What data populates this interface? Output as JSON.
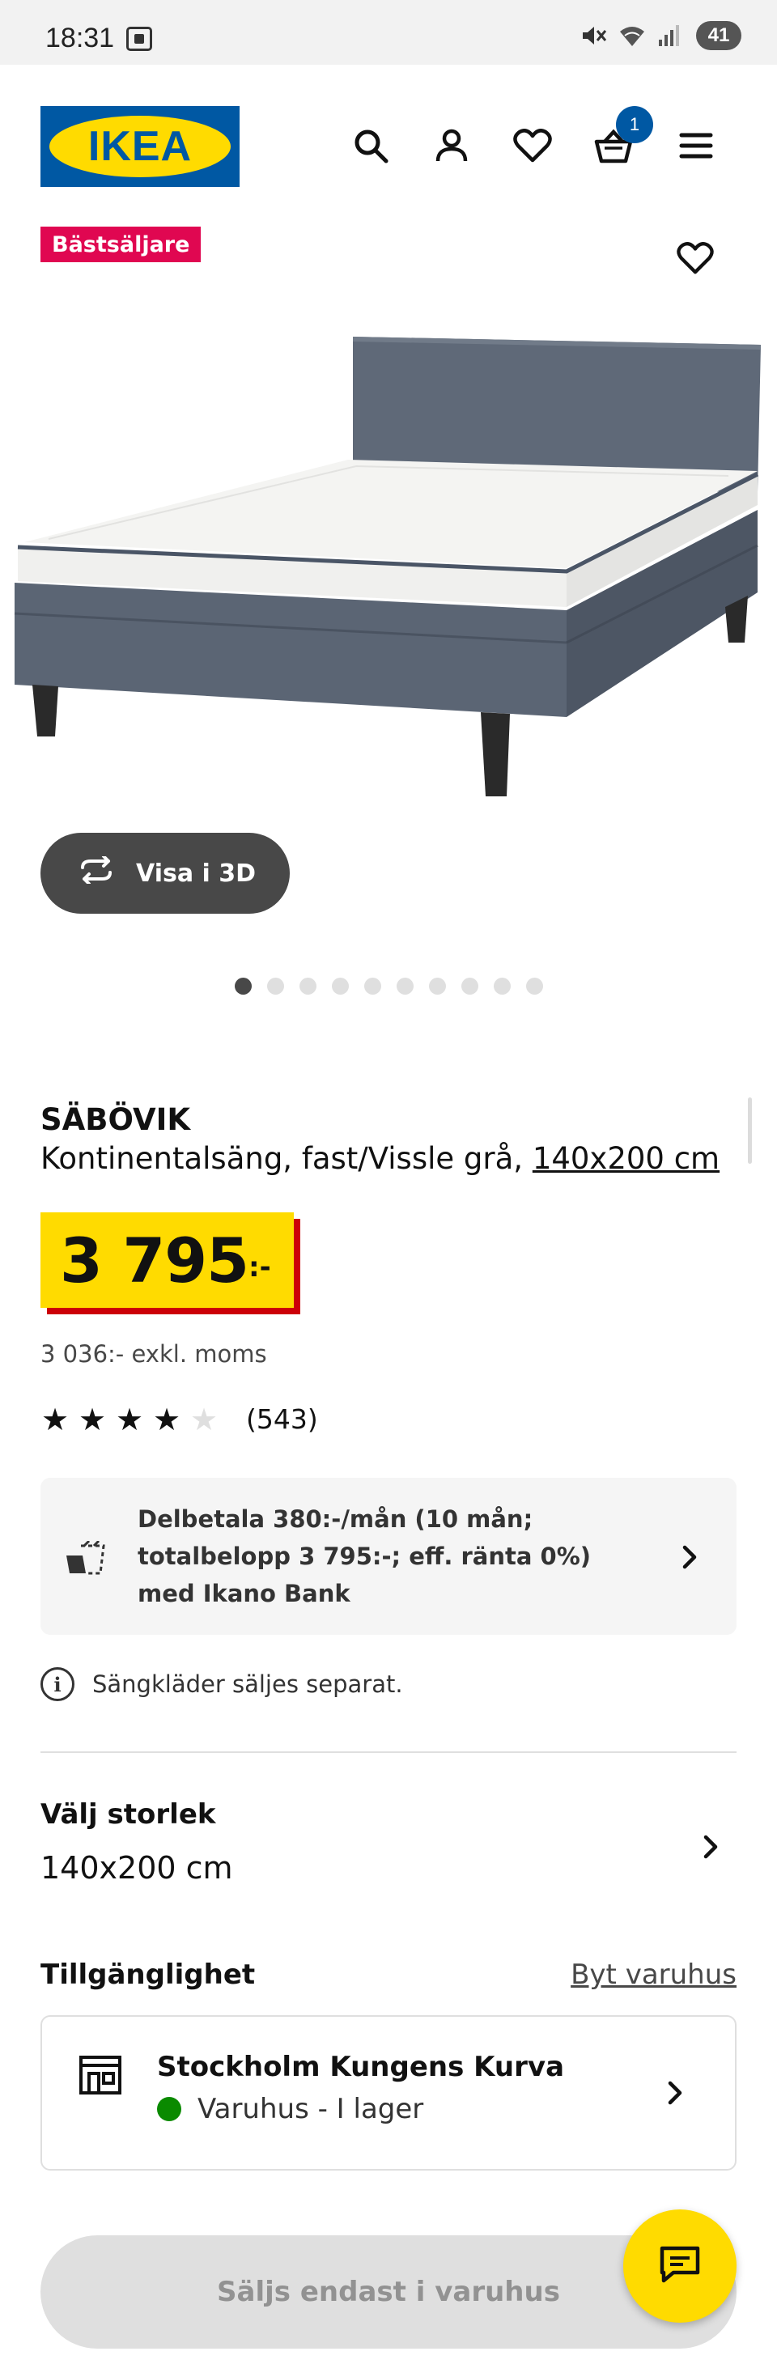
{
  "status_bar": {
    "time": "18:31",
    "battery": "41",
    "icons": [
      "screen-record-icon",
      "mute-icon",
      "wifi-icon",
      "signal-icon",
      "battery-icon"
    ]
  },
  "header": {
    "logo_text": "IKEA",
    "cart_count": "1",
    "icons": [
      "search-icon",
      "account-icon",
      "heart-icon",
      "cart-icon",
      "menu-icon"
    ]
  },
  "product": {
    "badge": "Bästsäljare",
    "view_3d_label": "Visa i 3D",
    "image_count": 10,
    "active_image": 1,
    "name": "SÄBÖVIK",
    "description": "Kontinentalsäng, fast/Vissle grå, ",
    "size_link": "140x200 cm",
    "price": "3 795",
    "price_suffix": ":-",
    "price_exkl": "3 036:- exkl. moms",
    "rating": 4,
    "rating_max": 5,
    "reviews": "(543)",
    "finance_text": "Delbetala 380:-/mån (10 mån; totalbelopp 3 795:-; eff. ränta 0%) med Ikano Bank",
    "note": "Sängkläder säljes separat."
  },
  "size_selector": {
    "label": "Välj storlek",
    "value": "140x200 cm"
  },
  "availability": {
    "label": "Tillgänglighet",
    "change_store": "Byt varuhus",
    "store_name": "Stockholm Kungens Kurva",
    "store_status": "Varuhus - I lager"
  },
  "buy_button": "Säljs endast i varuhus",
  "colors": {
    "ikea_blue": "#0058a3",
    "ikea_yellow": "#ffdb00",
    "badge_red": "#e00751",
    "price_shadow": "#cc0008",
    "stock_green": "#0a8a00"
  }
}
